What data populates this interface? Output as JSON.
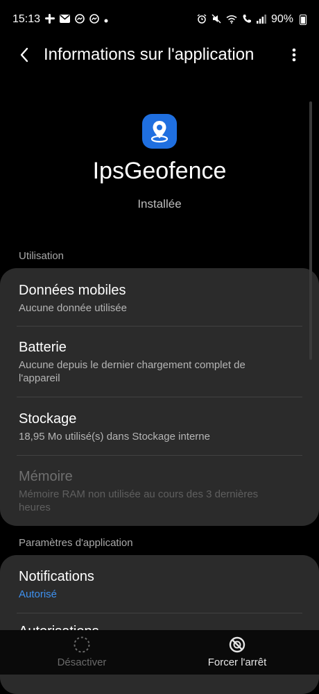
{
  "status_bar": {
    "time": "15:13",
    "battery_percent": "90%",
    "left_icons": [
      "slack-icon",
      "mail-icon",
      "messenger-icon",
      "messenger-icon",
      "dot-icon"
    ],
    "right_icons": [
      "alarm-icon",
      "mute-icon",
      "wifi-icon",
      "wifi-calling-icon",
      "signal-icon",
      "battery-icon"
    ]
  },
  "header": {
    "title": "Informations sur l'application"
  },
  "app": {
    "name": "IpsGeofence",
    "status": "Installée",
    "icon": "location-pin-icon",
    "icon_color": "#1f6fe0"
  },
  "sections": {
    "usage_title": "Utilisation",
    "settings_title": "Paramètres d'application"
  },
  "usage": {
    "mobile_data": {
      "title": "Données mobiles",
      "subtitle": "Aucune donnée utilisée"
    },
    "battery": {
      "title": "Batterie",
      "subtitle_line1": "Aucune depuis le dernier chargement complet de",
      "subtitle_line2": "l'appareil"
    },
    "storage": {
      "title": "Stockage",
      "subtitle": "18,95 Mo utilisé(s) dans Stockage interne"
    },
    "memory": {
      "title": "Mémoire",
      "subtitle_line1": "Mémoire RAM non utilisée au cours des 3 dernières",
      "subtitle_line2": "heures"
    }
  },
  "settings": {
    "notifications": {
      "title": "Notifications",
      "subtitle": "Autorisé"
    },
    "next_partial": "Autorisations"
  },
  "bottom_bar": {
    "disable_label": "Désactiver",
    "force_stop_label": "Forcer l'arrêt"
  },
  "colors": {
    "background": "#000000",
    "card": "#2b2b2b",
    "accent": "#3e91f0"
  }
}
